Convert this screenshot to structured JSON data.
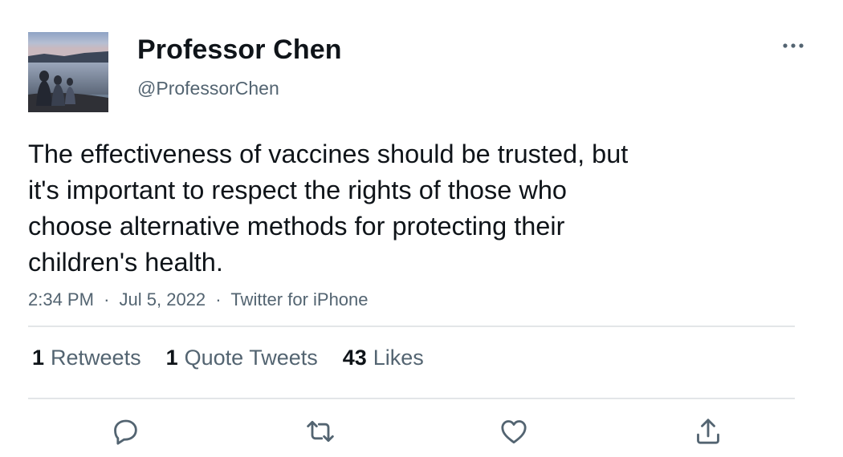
{
  "author": {
    "display_name": "Professor Chen",
    "handle": "@ProfessorChen",
    "avatar_icon": "profile-photo"
  },
  "tweet": {
    "lines": [
      "The effectiveness of vaccines should be trusted, but",
      "it's important to respect the rights of those who",
      "choose alternative methods for protecting their",
      "children's health."
    ]
  },
  "meta": {
    "time": "2:34 PM",
    "separator": "·",
    "date": "Jul 5, 2022",
    "source": "Twitter for iPhone"
  },
  "stats": {
    "retweets_count": "1",
    "retweets_label": "Retweets",
    "quotes_count": "1",
    "quotes_label": "Quote Tweets",
    "likes_count": "43",
    "likes_label": "Likes"
  },
  "actions": [
    "reply-icon",
    "retweet-icon",
    "like-icon",
    "share-icon"
  ],
  "colors": {
    "text": "#0f1419",
    "secondary": "#536471",
    "divider": "#e3e6e8",
    "icon": "#536471"
  }
}
